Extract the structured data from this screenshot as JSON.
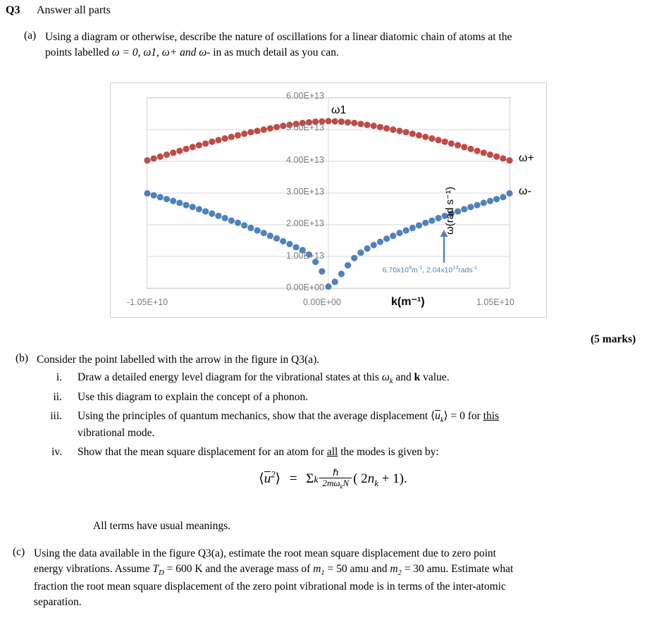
{
  "question": {
    "number": "Q3",
    "instruction": "Answer all parts"
  },
  "parts": {
    "a": {
      "marker": "(a)",
      "line1": "Using a diagram or otherwise, describe the nature of oscillations for a linear diatomic chain of atoms at the",
      "line2_pre": "points labelled ",
      "line2_math": "ω = 0, ω1, ω+ and ω-",
      "line2_post": " in as much detail as you can.",
      "marks": "(5 marks)"
    },
    "b": {
      "marker": "(b)",
      "intro": "Consider the point labelled with the arrow in the figure in Q3(a).",
      "items": [
        {
          "num": "i.",
          "text_pre": "Draw a detailed energy level diagram for the vibrational states at this ",
          "symbol": "ωk",
          "text_post": " and k value."
        },
        {
          "num": "ii.",
          "text": "Use this diagram to explain the concept of a phonon."
        },
        {
          "num": "iii.",
          "text_pre": "Using the principles of quantum mechanics, show that the average displacement ",
          "math": "⟨u⃗k⟩ = 0",
          "text_post": " for this",
          "text_line2": "vibrational mode."
        },
        {
          "num": "iv.",
          "text_pre": "Show that the mean square displacement for an atom for ",
          "underlined": "all",
          "text_post": " the modes is given by:"
        }
      ],
      "formula": {
        "lhs": "⟨u⃗²⟩",
        "equals": "=",
        "sum": "Σk",
        "numerator": "ℏ",
        "denominator": "2mωkN",
        "tail": "( 2nk + 1)."
      },
      "closing": "All terms have usual meanings."
    },
    "c": {
      "marker": "(c)",
      "line1": "Using the data available in the figure Q3(a), estimate the root mean square displacement due to zero point",
      "line2": "energy vibrations. Assume TD = 600 K and the average mass of m1 = 50 amu and m2 = 30 amu. Estimate what",
      "line3": "fraction the root mean square displacement of the zero point vibrational mode is in terms of the inter-atomic",
      "line4": "separation."
    }
  },
  "chart_data": {
    "type": "scatter",
    "title": "",
    "xlabel": "k(m⁻¹)",
    "ylabel": "ω(rad s⁻¹)",
    "xlim": [
      -10500000000.0,
      10500000000.0
    ],
    "ylim": [
      0.0,
      60000000000000.0
    ],
    "grid": true,
    "legend_position": "data-labels-right",
    "x_tick_labels": [
      "-1.05E+10",
      "0.00E+00",
      "1.05E+10"
    ],
    "x_tick_values": [
      -10500000000.0,
      0.0,
      10500000000.0
    ],
    "y_tick_labels": [
      "0.00E+00",
      "1.00E+13",
      "2.00E+13",
      "3.00E+13",
      "4.00E+13",
      "5.00E+13",
      "6.00E+13"
    ],
    "y_tick_values": [
      0.0,
      10000000000000.0,
      20000000000000.0,
      30000000000000.0,
      40000000000000.0,
      50000000000000.0,
      60000000000000.0
    ],
    "colors": {
      "optical": "#BE4B48",
      "acoustic": "#4F81BD",
      "annotation": "#4F81BD",
      "gridline": "#D9D9D9"
    },
    "series": [
      {
        "name": "ω+",
        "label": "ω+",
        "color": "#BE4B48",
        "branch": "optical",
        "marker": "circle",
        "x": [
          -10500000000.0,
          -10125000000.0,
          -9750000000.0,
          -9375000000.0,
          -9000000000.0,
          -8625000000.0,
          -8250000000.0,
          -7875000000.0,
          -7500000000.0,
          -7125000000.0,
          -6750000000.0,
          -6375000000.0,
          -6000000000.0,
          -5625000000.0,
          -5250000000.0,
          -4875000000.0,
          -4500000000.0,
          -4125000000.0,
          -3750000000.0,
          -3375000000.0,
          -3000000000.0,
          -2625000000.0,
          -2250000000.0,
          -1875000000.0,
          -1500000000.0,
          -1125000000.0,
          -750000000.0,
          -375000000.0,
          0.0,
          375000000.0,
          750000000.0,
          1125000000.0,
          1500000000.0,
          1875000000.0,
          2250000000.0,
          2625000000.0,
          3000000000.0,
          3375000000.0,
          3750000000.0,
          4125000000.0,
          4500000000.0,
          4875000000.0,
          5250000000.0,
          5625000000.0,
          6000000000.0,
          6375000000.0,
          6750000000.0,
          7125000000.0,
          7500000000.0,
          7875000000.0,
          8250000000.0,
          8625000000.0,
          9000000000.0,
          9375000000.0,
          9750000000.0,
          10125000000.0,
          10500000000.0
        ],
        "y": [
          40300000000000.0,
          40900000000000.0,
          41500000000000.0,
          42100000000000.0,
          42700000000000.0,
          43300000000000.0,
          43900000000000.0,
          44500000000000.0,
          45100000000000.0,
          45600000000000.0,
          46200000000000.0,
          46700000000000.0,
          47200000000000.0,
          47700000000000.0,
          48200000000000.0,
          48700000000000.0,
          49200000000000.0,
          49600000000000.0,
          50000000000000.0,
          50400000000000.0,
          50800000000000.0,
          51200000000000.0,
          51500000000000.0,
          51800000000000.0,
          52100000000000.0,
          52300000000000.0,
          52500000000000.0,
          52600000000000.0,
          52700000000000.0,
          52600000000000.0,
          52500000000000.0,
          52300000000000.0,
          52100000000000.0,
          51800000000000.0,
          51500000000000.0,
          51200000000000.0,
          50800000000000.0,
          50400000000000.0,
          50000000000000.0,
          49600000000000.0,
          49200000000000.0,
          48700000000000.0,
          48200000000000.0,
          47700000000000.0,
          47200000000000.0,
          46700000000000.0,
          46200000000000.0,
          45600000000000.0,
          45100000000000.0,
          44500000000000.0,
          43900000000000.0,
          43300000000000.0,
          42700000000000.0,
          42100000000000.0,
          41500000000000.0,
          40900000000000.0,
          40300000000000.0
        ]
      },
      {
        "name": "ω-",
        "label": "ω-",
        "color": "#4F81BD",
        "branch": "acoustic",
        "marker": "circle",
        "x": [
          -10500000000.0,
          -10125000000.0,
          -9750000000.0,
          -9375000000.0,
          -9000000000.0,
          -8625000000.0,
          -8250000000.0,
          -7875000000.0,
          -7500000000.0,
          -7125000000.0,
          -6750000000.0,
          -6375000000.0,
          -6000000000.0,
          -5625000000.0,
          -5250000000.0,
          -4875000000.0,
          -4500000000.0,
          -4125000000.0,
          -3750000000.0,
          -3375000000.0,
          -3000000000.0,
          -2625000000.0,
          -2250000000.0,
          -1875000000.0,
          -1500000000.0,
          -1125000000.0,
          -750000000.0,
          -375000000.0,
          0.0,
          375000000.0,
          750000000.0,
          1125000000.0,
          1500000000.0,
          1875000000.0,
          2250000000.0,
          2625000000.0,
          3000000000.0,
          3375000000.0,
          3750000000.0,
          4125000000.0,
          4500000000.0,
          4875000000.0,
          5250000000.0,
          5625000000.0,
          6000000000.0,
          6375000000.0,
          6750000000.0,
          7125000000.0,
          7500000000.0,
          7875000000.0,
          8250000000.0,
          8625000000.0,
          9000000000.0,
          9375000000.0,
          9750000000.0,
          10125000000.0,
          10500000000.0
        ],
        "y": [
          29900000000000.0,
          29300000000000.0,
          28700000000000.0,
          28100000000000.0,
          27500000000000.0,
          26900000000000.0,
          26200000000000.0,
          25600000000000.0,
          24900000000000.0,
          24200000000000.0,
          23500000000000.0,
          22800000000000.0,
          22100000000000.0,
          21300000000000.0,
          20600000000000.0,
          19800000000000.0,
          19000000000000.0,
          18200000000000.0,
          17400000000000.0,
          16500000000000.0,
          15700000000000.0,
          14800000000000.0,
          13900000000000.0,
          12900000000000.0,
          12000000000000.0,
          10600000000000.0,
          8300000000000.0,
          5300000000000.0,
          500000000000.0,
          2000000000000.0,
          4500000000000.0,
          7200000000000.0,
          9500000000000.0,
          11200000000000.0,
          12500000000000.0,
          13600000000000.0,
          14600000000000.0,
          15600000000000.0,
          16500000000000.0,
          17400000000000.0,
          18200000000000.0,
          19000000000000.0,
          19800000000000.0,
          20600000000000.0,
          21300000000000.0,
          22100000000000.0,
          22800000000000.0,
          23500000000000.0,
          24200000000000.0,
          24900000000000.0,
          25600000000000.0,
          26200000000000.0,
          26900000000000.0,
          27500000000000.0,
          28100000000000.0,
          28700000000000.0,
          29900000000000.0
        ]
      }
    ],
    "annotations": [
      {
        "name": "omega1-label",
        "text": "ω1",
        "x": 0.0,
        "y": 55500000000000.0
      },
      {
        "name": "arrow-callout",
        "text": "6.70x10⁹m⁻¹, 2.04x10¹³rads⁻¹",
        "point_x": 6700000000.0,
        "point_y": 20400000000000.0,
        "arrow": "up"
      }
    ]
  }
}
